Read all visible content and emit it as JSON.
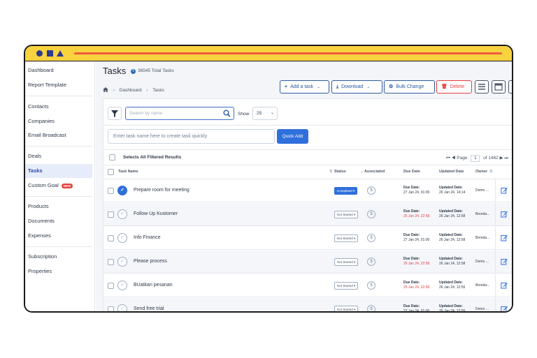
{
  "sidebar": {
    "items": [
      {
        "label": "Dashboard"
      },
      {
        "label": "Report Template"
      },
      {
        "label": "Contacts"
      },
      {
        "label": "Companies"
      },
      {
        "label": "Email Broadcast"
      },
      {
        "label": "Deals"
      },
      {
        "label": "Tasks"
      },
      {
        "label": "Custom Goal",
        "badge": "NEW"
      },
      {
        "label": "Products"
      },
      {
        "label": "Documents"
      },
      {
        "label": "Expenses"
      },
      {
        "label": "Subscription"
      },
      {
        "label": "Properties"
      }
    ],
    "active": "Tasks"
  },
  "header": {
    "title": "Tasks",
    "total": "36545 Total Tasks",
    "breadcrumb": [
      "Dashboard",
      "Tasks"
    ]
  },
  "toolbar": {
    "add": "Add a task",
    "download": "Download",
    "bulk": "Bulk Change",
    "delete": "Delete"
  },
  "filters": {
    "search_placeholder": "Search by name",
    "show_label": "Show",
    "show_value": "25",
    "quick_placeholder": "Enter task name here to create task quickly",
    "quick_button": "Quick Add",
    "select_all": "Selects All Filtered Results",
    "page_label": "Page",
    "page_value": "1",
    "page_total": "of 1462"
  },
  "columns": {
    "name": "Task Name",
    "status": "Status",
    "associated": "Associated",
    "due": "Due Date",
    "updated": "Updated Date",
    "owner": "Owner"
  },
  "rows": [
    {
      "name": "Prepare room for meeting",
      "done": true,
      "status": "Completed",
      "due_label": "Due Date:",
      "due": "27 Jan 24, 01:00",
      "due_red": false,
      "upd_label": "Updated Date:",
      "upd": "26 Jan 24, 14:14",
      "owner": "Demo ..."
    },
    {
      "name": "Follow Up Kustomer",
      "done": false,
      "status": "Not Started",
      "due_label": "Due Date:",
      "due": "25 Jan 24, 22:58",
      "due_red": true,
      "upd_label": "Updated Date:",
      "upd": "26 Jan 24, 12:58",
      "owner": "Brenda..."
    },
    {
      "name": "Info Finance",
      "done": false,
      "status": "Not Started",
      "due_label": "Due Date:",
      "due": "27 Jan 24, 01:00",
      "due_red": false,
      "upd_label": "Updated Date:",
      "upd": "26 Jan 24, 12:58",
      "owner": "Brenda..."
    },
    {
      "name": "Please process",
      "done": false,
      "status": "Not Started",
      "due_label": "Due Date:",
      "due": "26 Jan 24, 22:58",
      "due_red": true,
      "upd_label": "Updated Date:",
      "upd": "26 Jan 24, 12:58",
      "owner": "Demo ..."
    },
    {
      "name": "BUatkan pesanan",
      "done": false,
      "status": "Not Started",
      "due_label": "Due Date:",
      "due": "25 Jan 24, 22:58",
      "due_red": true,
      "upd_label": "Updated Date:",
      "upd": "26 Jan 24, 12:55",
      "owner": "Brenda..."
    },
    {
      "name": "Send free trial",
      "done": false,
      "status": "Not Started",
      "due_label": "Due Date:",
      "due": "27 Jan 24, 01:00",
      "due_red": false,
      "upd_label": "Updated Date:",
      "upd": "26 Jan 24, 12:55",
      "owner": "Demo ..."
    }
  ],
  "colors": {
    "accent": "#2f6fdb",
    "danger": "#e53e3e",
    "topbar": "#f8d23f"
  }
}
